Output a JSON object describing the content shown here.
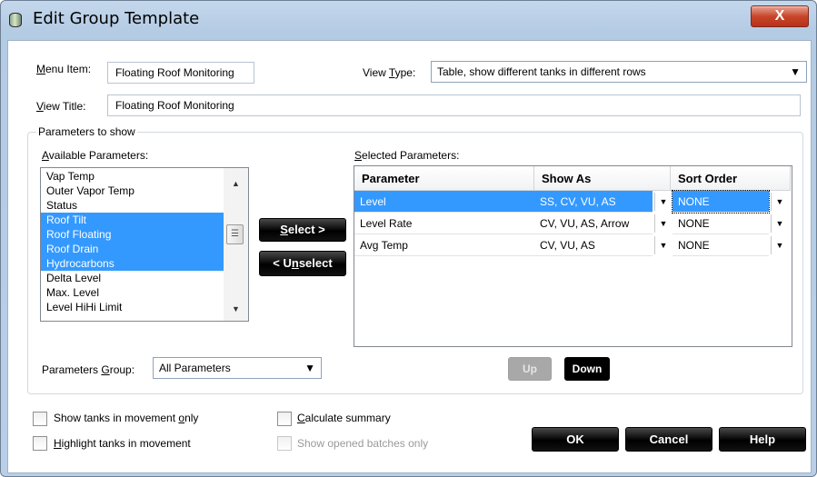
{
  "window": {
    "title": "Edit Group Template",
    "close_label": "X"
  },
  "menu_item": {
    "label": "Menu Item:",
    "value": "Floating Roof Monitoring"
  },
  "view_type": {
    "label": "View Type:",
    "value": "Table, show different tanks in different rows"
  },
  "view_title": {
    "label": "View Title:",
    "value": "Floating Roof Monitoring"
  },
  "params_group_title": "Parameters to show",
  "available": {
    "label": "Available Parameters:",
    "items": [
      {
        "label": "Vap Temp",
        "selected": false
      },
      {
        "label": "Outer Vapor Temp",
        "selected": false
      },
      {
        "label": "Status",
        "selected": false
      },
      {
        "label": "Roof Tilt",
        "selected": true
      },
      {
        "label": "Roof Floating",
        "selected": true
      },
      {
        "label": "Roof Drain",
        "selected": true
      },
      {
        "label": "Hydrocarbons",
        "selected": true
      },
      {
        "label": "Delta Level",
        "selected": false
      },
      {
        "label": "Max. Level",
        "selected": false
      },
      {
        "label": "Level HiHi Limit",
        "selected": false
      }
    ]
  },
  "buttons": {
    "select": "Select >",
    "unselect": "< Unselect",
    "up": "Up",
    "down": "Down",
    "ok": "OK",
    "cancel": "Cancel",
    "help": "Help"
  },
  "selected": {
    "label": "Selected Parameters:",
    "columns": [
      "Parameter",
      "Show As",
      "Sort Order"
    ],
    "rows": [
      {
        "parameter": "Level",
        "show_as": "SS, CV, VU, AS",
        "sort_order": "NONE",
        "selected": true
      },
      {
        "parameter": "Level Rate",
        "show_as": "CV, VU, AS, Arrow",
        "sort_order": "NONE",
        "selected": false
      },
      {
        "parameter": "Avg Temp",
        "show_as": "CV, VU, AS",
        "sort_order": "NONE",
        "selected": false
      }
    ]
  },
  "parameters_group": {
    "label": "Parameters Group:",
    "value": "All Parameters"
  },
  "options": {
    "show_moving": {
      "label": "Show tanks in movement only",
      "checked": false
    },
    "highlight_moving": {
      "label": "Highlight tanks in movement",
      "checked": false
    },
    "calculate_summary": {
      "label": "Calculate summary",
      "checked": false
    },
    "show_opened_batches": {
      "label": "Show opened batches only",
      "checked": false,
      "disabled": true
    }
  },
  "colors": {
    "selection": "#3399ff",
    "title_bar": "#b9d1ea",
    "close_button": "#c7462b"
  }
}
